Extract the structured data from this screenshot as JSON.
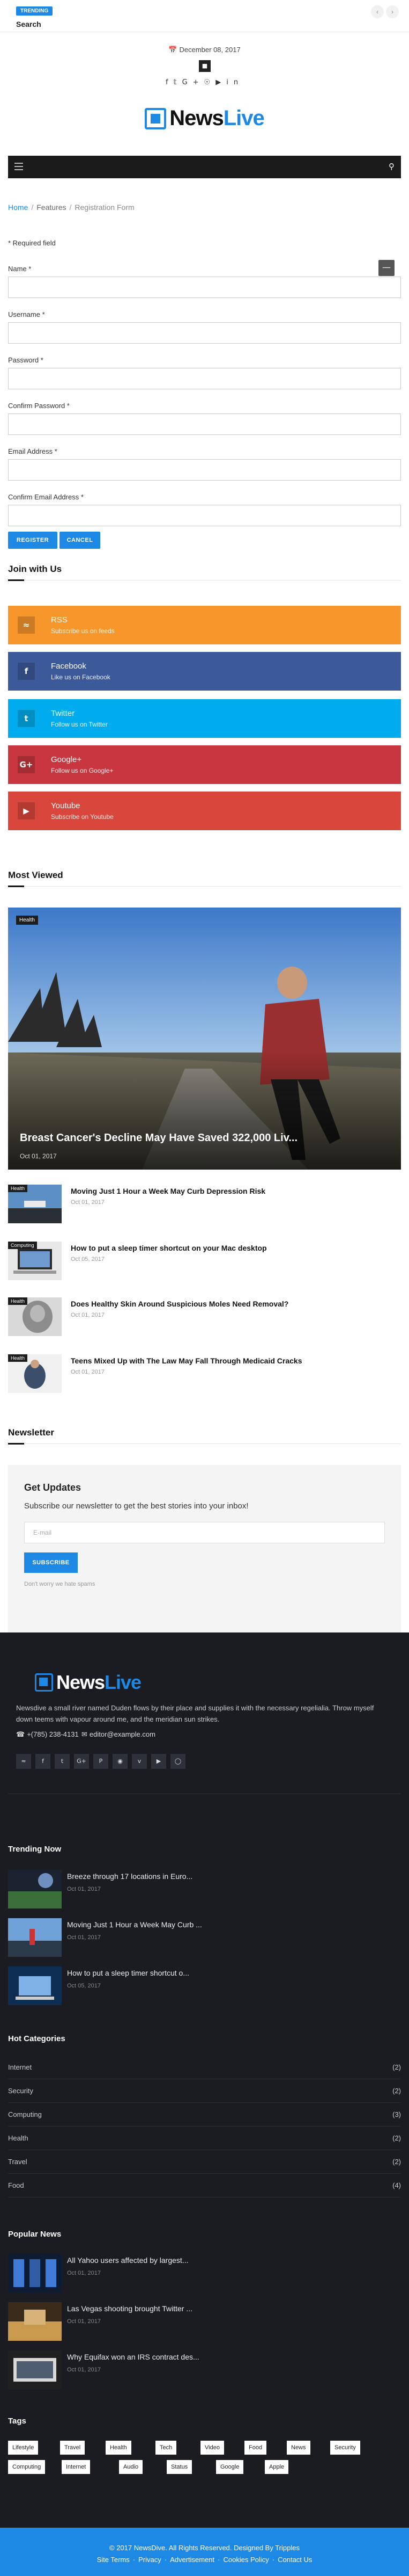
{
  "topbar": {
    "trending_badge": "TRENDING",
    "trending_title": "Search",
    "prev_icon": "chevron-left-icon",
    "next_icon": "chevron-right-icon"
  },
  "header": {
    "date_icon": "calendar-icon",
    "date": "December 08, 2017",
    "social_icons": [
      "facebook-icon",
      "twitter-icon",
      "google-plus-icon",
      "pinterest-icon",
      "youtube-icon",
      "linkedin-icon"
    ]
  },
  "logo": {
    "part1": "News",
    "part2": "Live",
    "brand_color": "#1e88e5"
  },
  "breadcrumb": {
    "home": "Home",
    "features": "Features",
    "current": "Registration Form"
  },
  "form": {
    "required_note": "* Required field",
    "fields": [
      {
        "label": "Name *",
        "value": ""
      },
      {
        "label": "Username *",
        "value": ""
      },
      {
        "label": "Password *",
        "value": ""
      },
      {
        "label": "Confirm Password *",
        "value": ""
      },
      {
        "label": "Email Address *",
        "value": ""
      },
      {
        "label": "Confirm Email Address *",
        "value": ""
      }
    ],
    "register_label": "REGISTER",
    "cancel_label": "CANCEL"
  },
  "join": {
    "title": "Join with Us",
    "items": [
      {
        "name": "RSS",
        "sub": "Subscribe us on feeds",
        "color": "#f7962b",
        "icon": "rss-icon"
      },
      {
        "name": "Facebook",
        "sub": "Like us on Facebook",
        "color": "#3c5a9a",
        "icon": "facebook-icon"
      },
      {
        "name": "Twitter",
        "sub": "Follow us on Twitter",
        "color": "#00aced",
        "icon": "twitter-icon"
      },
      {
        "name": "Google+",
        "sub": "Follow us on Google+",
        "color": "#c83740",
        "icon": "google-plus-icon"
      },
      {
        "name": "Youtube",
        "sub": "Subscribe on Youtube",
        "color": "#d9473c",
        "icon": "youtube-icon"
      }
    ]
  },
  "most_viewed": {
    "title": "Most Viewed",
    "hero": {
      "category": "Health",
      "title": "Breast Cancer's Decline May Have Saved 322,000 Liv...",
      "date": "Oct 01, 2017"
    },
    "items": [
      {
        "category": "Health",
        "title": "Moving Just 1 Hour a Week May Curb Depression Risk",
        "date": "Oct 01, 2017"
      },
      {
        "category": "Computing",
        "title": "How to put a sleep timer shortcut on your Mac desktop",
        "date": "Oct 05, 2017"
      },
      {
        "category": "Health",
        "title": "Does Healthy Skin Around Suspicious Moles Need Removal?",
        "date": "Oct 01, 2017"
      },
      {
        "category": "Health",
        "title": "Teens Mixed Up with The Law May Fall Through Medicaid Cracks",
        "date": "Oct 01, 2017"
      }
    ]
  },
  "newsletter": {
    "title": "Newsletter",
    "box_title": "Get Updates",
    "text": "Subscribe our newsletter to get the best stories into your inbox!",
    "placeholder": "E-mail",
    "button": "SUBSCRIBE",
    "note": "Don't worry we hate spams"
  },
  "footer": {
    "about": "Newsdive a small river named Duden flows by their place and supplies it with the necessary regelialia. Throw myself down teems with vapour around me, and the meridian sun strikes.",
    "phone": "+(785) 238-4131",
    "email": "editor@example.com",
    "social_icons": [
      "rss-icon",
      "facebook-icon",
      "twitter-icon",
      "google-plus-icon",
      "pinterest-icon",
      "dribbble-icon",
      "vimeo-icon",
      "youtube-icon",
      "instagram-icon"
    ],
    "trending": {
      "title": "Trending Now",
      "items": [
        {
          "title": "Breeze through 17 locations in Euro...",
          "date": "Oct 01, 2017"
        },
        {
          "title": "Moving Just 1 Hour a Week May Curb ...",
          "date": "Oct 01, 2017"
        },
        {
          "title": "How to put a sleep timer shortcut o...",
          "date": "Oct 05, 2017"
        }
      ]
    },
    "hot_categories": {
      "title": "Hot Categories",
      "items": [
        {
          "name": "Internet",
          "count": "(2)"
        },
        {
          "name": "Security",
          "count": "(2)"
        },
        {
          "name": "Computing",
          "count": "(3)"
        },
        {
          "name": "Health",
          "count": "(2)"
        },
        {
          "name": "Travel",
          "count": "(2)"
        },
        {
          "name": "Food",
          "count": "(4)"
        }
      ]
    },
    "popular": {
      "title": "Popular News",
      "items": [
        {
          "title": "All Yahoo users affected by largest...",
          "date": "Oct 01, 2017"
        },
        {
          "title": "Las Vegas shooting brought Twitter ...",
          "date": "Oct 01, 2017"
        },
        {
          "title": "Why Equifax won an IRS contract des...",
          "date": "Oct 01, 2017"
        }
      ]
    },
    "tags": {
      "title": "Tags",
      "row1": [
        "Lifestyle",
        "Travel",
        "Health",
        "Tech",
        "Video",
        "Food",
        "News",
        "Security"
      ],
      "row2": [
        "Computing",
        "Internet",
        "Audio",
        "Status",
        "Google",
        "Apple"
      ]
    },
    "copyright": "© 2017 NewsDive. All Rights Reserved. Designed By Tripples",
    "links": [
      "Site Terms",
      "Privacy",
      "Advertisement",
      "Cookies Policy",
      "Contact Us"
    ]
  }
}
